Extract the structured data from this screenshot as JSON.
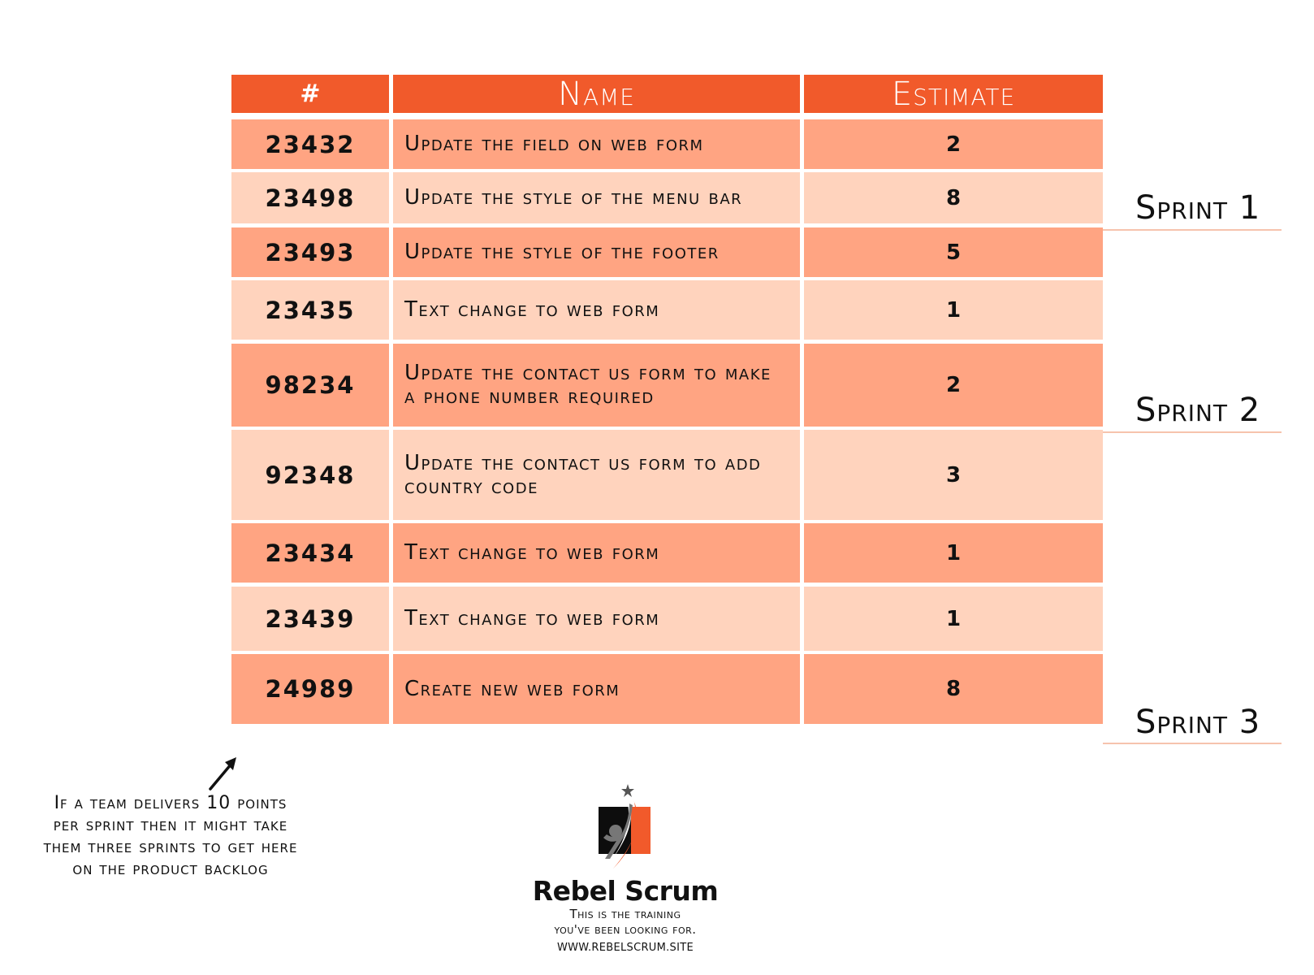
{
  "table": {
    "headers": {
      "id": "#",
      "name": "Name",
      "estimate": "Estimate"
    },
    "rows": [
      {
        "id": "23432",
        "name": "Update the field on web form",
        "estimate": "2",
        "shade": "dark"
      },
      {
        "id": "23498",
        "name": "Update the style of the menu bar",
        "estimate": "8",
        "shade": "light"
      },
      {
        "id": "23493",
        "name": "Update the style of the footer",
        "estimate": "5",
        "shade": "dark"
      },
      {
        "id": "23435",
        "name": "Text change to web form",
        "estimate": "1",
        "shade": "light"
      },
      {
        "id": "98234",
        "name": "Update the contact us form to make a phone number required",
        "estimate": "2",
        "shade": "dark"
      },
      {
        "id": "92348",
        "name": "Update the contact us form to add country code",
        "estimate": "3",
        "shade": "light"
      },
      {
        "id": "23434",
        "name": "Text change to web form",
        "estimate": "1",
        "shade": "dark"
      },
      {
        "id": "23439",
        "name": "Text change to web form",
        "estimate": "1",
        "shade": "light"
      },
      {
        "id": "24989",
        "name": "Create new web form",
        "estimate": "8",
        "shade": "dark"
      }
    ]
  },
  "sprints": [
    {
      "label": "Sprint 1"
    },
    {
      "label": "Sprint 2"
    },
    {
      "label": "Sprint 3"
    }
  ],
  "annotation": {
    "text": "If a team delivers 10 points per sprint then it might take them three sprints to get here on the product backlog",
    "arrow_icon": "arrow-up-right-icon"
  },
  "logo": {
    "brand": "Rebel Scrum",
    "tagline_1": "This is the training",
    "tagline_2": "you've been looking for.",
    "website": "WWW.REBELSCRUM.SITE"
  },
  "colors": {
    "header": "#f15a2b",
    "row_dark": "#ffa482",
    "row_light": "#ffd3bd",
    "sprint_line": "#f6c3ad"
  }
}
